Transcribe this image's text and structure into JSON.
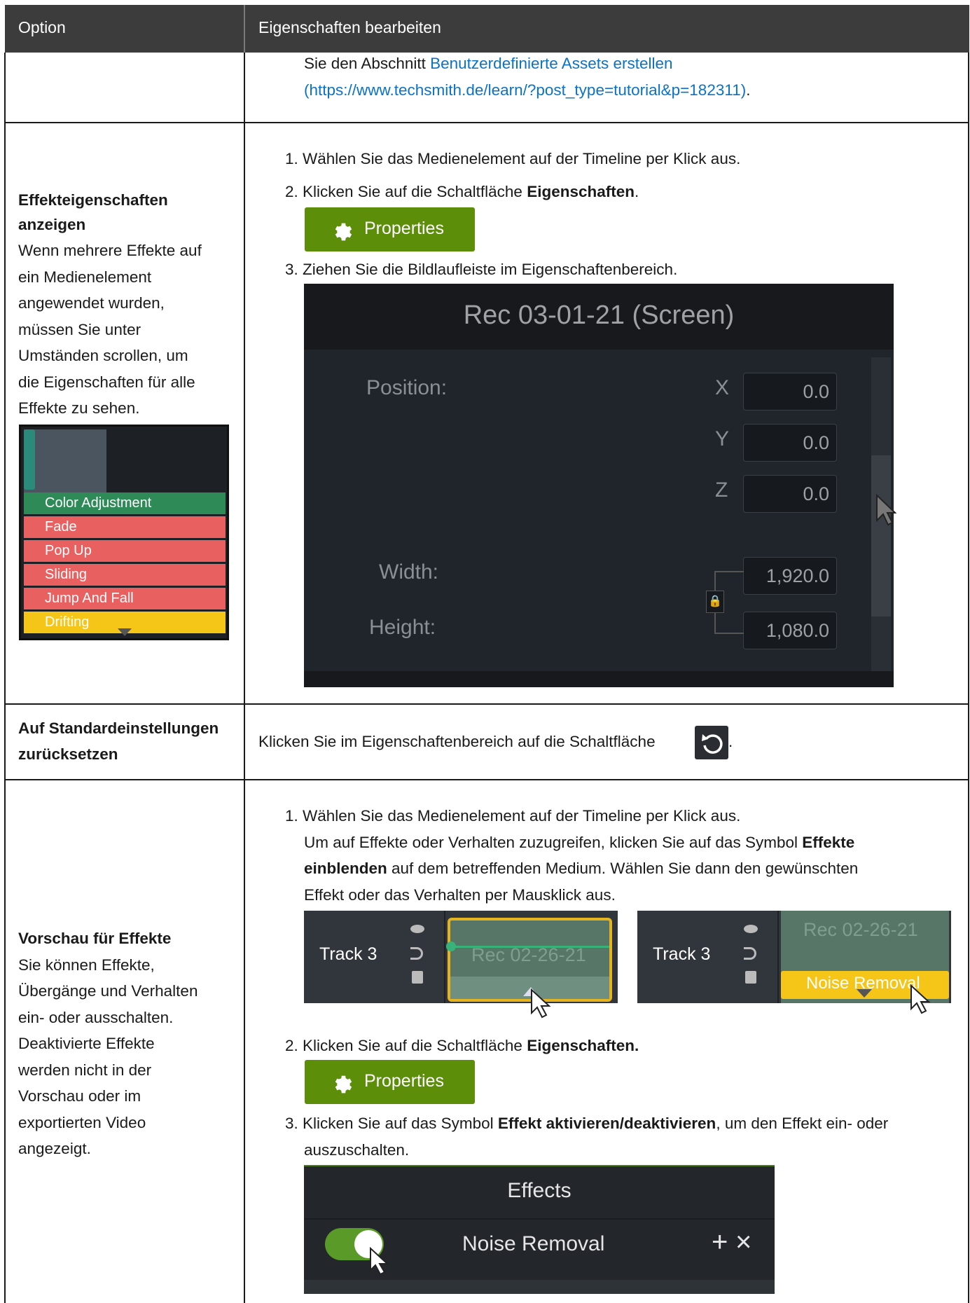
{
  "header": {
    "col1": "Option",
    "col2": "Eigenschaften bearbeiten"
  },
  "row0": {
    "text_pre": "Sie den Abschnitt ",
    "link_text": "Benutzerdefinierte Assets erstellen",
    "link_url": "(https://www.techsmith.de/learn/?post_type=tutorial&p=182311)",
    "text_post": "."
  },
  "row1": {
    "title_line1": "Effekteigenschaften",
    "title_line2": "anzeigen",
    "desc_lines": [
      "Wenn mehrere Effekte auf",
      "ein Medienelement",
      "angewendet wurden,",
      "müssen Sie unter",
      "Umständen scrollen, um",
      "die Eigenschaften für alle",
      "Effekte zu sehen."
    ],
    "effects_stack": [
      "Color Adjustment",
      "Fade",
      "Pop Up",
      "Sliding",
      "Jump And Fall",
      "Drifting"
    ],
    "step1": "1. Wählen Sie das Medienelement auf der Timeline per Klick aus.",
    "step2_pre": "2. Klicken Sie auf die Schaltfläche ",
    "step2_bold": "Eigenschaften",
    "step2_post": ".",
    "properties_button": "Properties",
    "step3": "3. Ziehen Sie die Bildlaufleiste im Eigenschaftenbereich.",
    "panel": {
      "title": "Rec 03-01-21 (Screen)",
      "position_label": "Position:",
      "x_label": "X",
      "x_value": "0.0",
      "y_label": "Y",
      "y_value": "0.0",
      "z_label": "Z",
      "z_value": "0.0",
      "width_label": "Width:",
      "width_value": "1,920.0",
      "height_label": "Height:",
      "height_value": "1,080.0"
    }
  },
  "row2": {
    "title_line1": "Auf Standardeinstellungen",
    "title_line2": "zurücksetzen",
    "text": "Klicken Sie im Eigenschaftenbereich auf die Schaltfläche",
    "text_post": "."
  },
  "row3": {
    "title": "Vorschau für Effekte",
    "desc_lines": [
      "Sie können Effekte,",
      "Übergänge und Verhalten",
      "ein- oder ausschalten.",
      "Deaktivierte Effekte",
      "werden nicht in der",
      "Vorschau oder im",
      "exportierten Video",
      "angezeigt."
    ],
    "step1": "1. Wählen Sie das Medienelement auf der Timeline per Klick aus.",
    "step1b_pre": "Um auf Effekte oder Verhalten zuzugreifen, klicken Sie auf das Symbol ",
    "step1b_bold1": "Effekte",
    "step1b_bold2": "einblenden",
    "step1b_post": " auf dem betreffenden Medium. Wählen Sie dann den gewünschten",
    "step1b_line3": "Effekt oder das Verhalten per Mausklick aus.",
    "track_label": "Track 3",
    "clip_label": "Rec 02-26-21",
    "noise_label": "Noise Removal",
    "step2_pre": "2. Klicken Sie auf die Schaltfläche ",
    "step2_bold": "Eigenschaften.",
    "properties_button": "Properties",
    "step3_pre": "3. Klicken Sie auf das Symbol ",
    "step3_bold": "Effekt aktivieren/deaktivieren",
    "step3_post": ", um den Effekt ein- oder",
    "step3_line2": "auszuschalten.",
    "effects_title": "Effects",
    "effects_item": "Noise Removal",
    "effects_plus": "+",
    "effects_x": "×"
  },
  "colors": {
    "header_bg": "#3c3c3c",
    "link": "#0b72c7",
    "button_green": "#5c8e0a",
    "fx_green": "#2e8b57",
    "fx_red": "#e86060",
    "fx_yellow": "#f5c518"
  }
}
